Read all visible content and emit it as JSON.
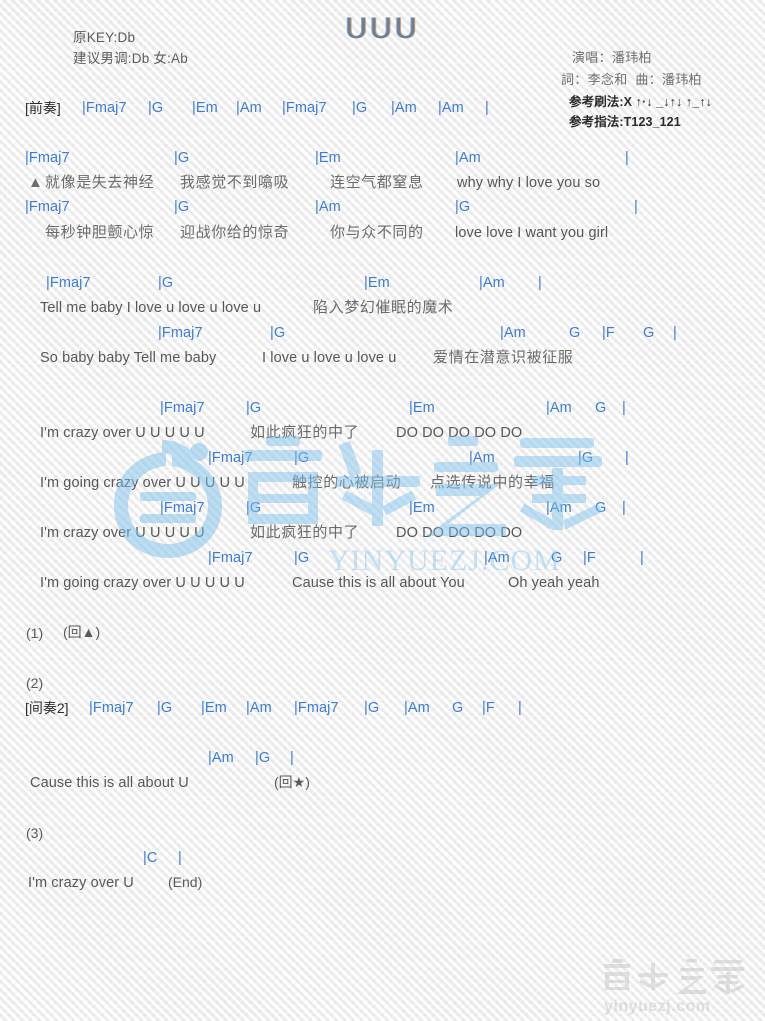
{
  "title": "UUU",
  "header": {
    "original_key_label": "原KEY:Db",
    "suggested_key_label": "建议男调:Db 女:Ab",
    "singer": "演唱：潘玮柏",
    "writer": "詞：李念和  曲：潘玮柏",
    "strum_pattern": "参考刷法:X ↑·↓ _↓↑↓ ↑_↑↓",
    "finger_pattern": "参考指法:T123_121"
  },
  "watermarks": {
    "center_text": "音乐之家",
    "center_url": "YINYUEZJ.COM",
    "bottom_text": "音乐之家",
    "bottom_url": "yinyuezj.com"
  },
  "intro": {
    "tag": "[前奏]",
    "chords": [
      "|Fmaj7",
      "|G",
      "|Em",
      "|Am",
      "|Fmaj7",
      "|G",
      "|Am",
      "|Am",
      "|"
    ]
  },
  "verse1": {
    "line1_chords": [
      "|Fmaj7",
      "|G",
      "|Em",
      "|Am",
      "|"
    ],
    "line1_lyric_marker": "▲",
    "line1_lyrics": [
      "就像是失去神经",
      "我感觉不到噏吸",
      "连空气都窒息",
      "why why I love you so"
    ],
    "line2_chords": [
      "|Fmaj7",
      "|G",
      "|Am",
      "|G",
      "|"
    ],
    "line2_lyrics": [
      "每秒钟胆颤心惊",
      "迎战你给的惊奇",
      "你与众不同的",
      "love love I want you girl"
    ]
  },
  "prechorus": {
    "line1_chords": [
      "|Fmaj7",
      "|G",
      "|Em",
      "|Am",
      "|"
    ],
    "line1_lyrics": [
      "Tell me baby I love u love u love u",
      "陷入梦幻催眠的魔术"
    ],
    "line2_chords": [
      "|Fmaj7",
      "|G",
      "|Am",
      "G",
      "|F",
      "G",
      "|"
    ],
    "line2_lyrics": [
      "So baby baby Tell me baby",
      "I love u love u love u",
      "爱情在潜意识被征服"
    ]
  },
  "chorus1": {
    "line1_chords": [
      "|Fmaj7",
      "|G",
      "|Em",
      "|Am",
      "G",
      "|"
    ],
    "line1_lyrics": [
      "I'm crazy over U U U U U",
      "如此疯狂的中了",
      "DO DO DO DO DO"
    ],
    "line2_chords": [
      "|Fmaj7",
      "|G",
      "|Am",
      "|G",
      "|"
    ],
    "line2_lyrics": [
      "I'm going crazy over U U U U U",
      "触控的心被启动",
      "点选传说中的幸福"
    ]
  },
  "chorus2": {
    "line1_chords": [
      "|Fmaj7",
      "|G",
      "|Em",
      "|Am",
      "G",
      "|"
    ],
    "line1_lyrics": [
      "I'm crazy over U U U U U",
      "如此疯狂的中了",
      "DO DO DO DO DO"
    ],
    "line2_chords": [
      "|Fmaj7",
      "|G",
      "|Am",
      "G",
      "|F",
      "|"
    ],
    "line2_lyrics": [
      "I'm going crazy over U U U U U",
      "Cause this is all about You",
      "Oh yeah yeah"
    ]
  },
  "ending1": {
    "number": "(1)",
    "repeat": "(回▲)"
  },
  "ending2": {
    "number": "(2)",
    "tag": "[间奏2]",
    "chords": [
      "|Fmaj7",
      "|G",
      "|Em",
      "|Am",
      "|Fmaj7",
      "|G",
      "|Am",
      "G",
      "|F",
      "|"
    ],
    "line_chords": [
      "|Am",
      "|G",
      "|"
    ],
    "lyric": "Cause this is all about U",
    "repeat": "(回★)"
  },
  "ending3": {
    "number": "(3)",
    "chords": [
      "|C",
      "|"
    ],
    "lyric": "I'm crazy over U",
    "end_marker": "(End)"
  }
}
